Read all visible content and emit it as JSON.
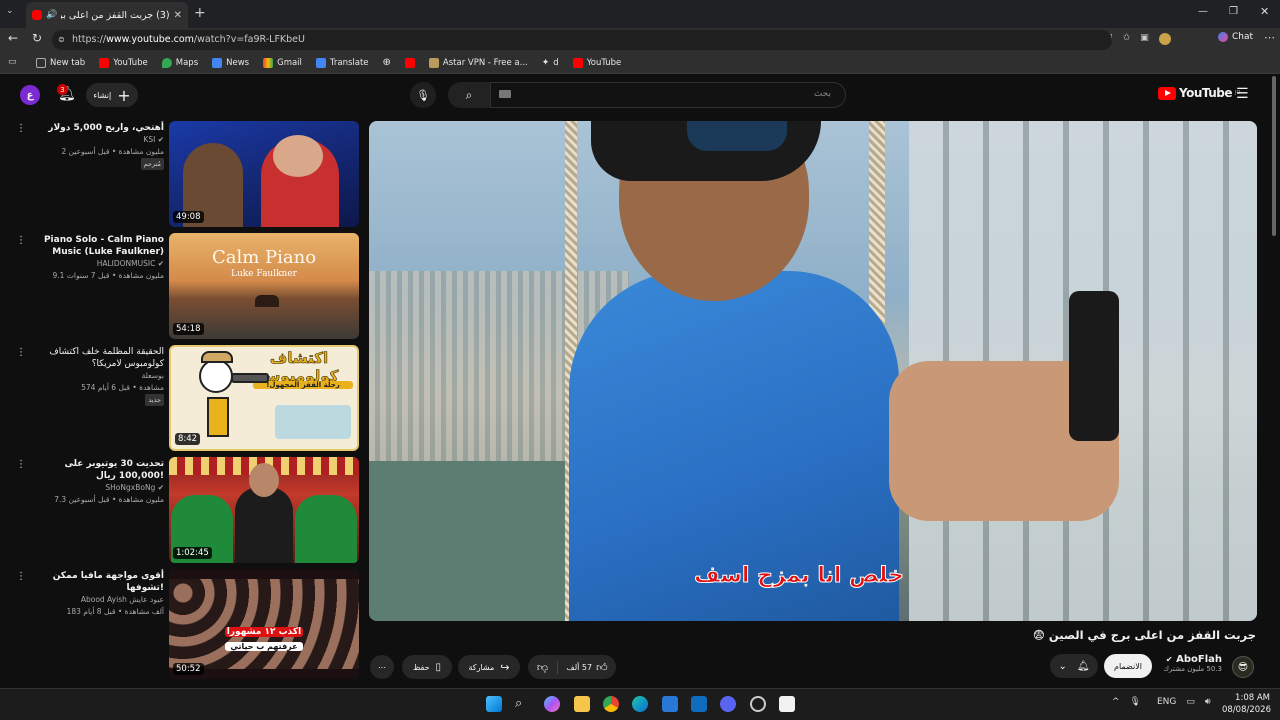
{
  "browser": {
    "tab_title": "(3) جربت القفز من اعلى برج فى",
    "url_prefix": "https://",
    "url_domain": "www.youtube.com",
    "url_path": "/watch?v=fa9R-LFKbeU",
    "chat_label": "Chat",
    "bookmarks": [
      "New tab",
      "YouTube",
      "Maps",
      "News",
      "Gmail",
      "Translate",
      "",
      "",
      "Astar VPN - Free a...",
      "d",
      "YouTube"
    ]
  },
  "youtube": {
    "create_label": "إنشاء",
    "notif_count": "3",
    "search_placeholder": "بحث",
    "logo_text": "YouTube",
    "logo_country": "JO"
  },
  "recommendations": [
    {
      "title": "أهتحي، واربح 5,000 دولار",
      "channel": "KSI",
      "stats": "2 مليون مشاهدة • قبل أسبوعين",
      "badge": "مُترجم",
      "duration": "49:08"
    },
    {
      "title": "Piano Solo - Calm Piano Music (Luke Faulkner)",
      "channel": "HALIDONMUSIC",
      "stats": "9.1 مليون مشاهدة • قبل 7 سنوات",
      "badge": "",
      "duration": "54:18",
      "thumb_title": "Calm Piano",
      "thumb_sub": "Luke Faulkner"
    },
    {
      "title": "الحقيقة المظلمة خلف اكتشاف كولومبوس لامريكا؟",
      "channel": "بوسعلة",
      "stats": "574 مشاهدة • قبل 6 أيام",
      "badge": "جديد",
      "duration": "8:42",
      "thumb_title": "اكتشاف كولومبوس",
      "thumb_sub": "رحلة القفز المجهول!"
    },
    {
      "title": "تحديت 30 يوتيوبر على 100,000 ريال!",
      "channel": "SHoNgxBoNg",
      "stats": "7.3 مليون مشاهدة • قبل أسبوعين",
      "badge": "",
      "duration": "1:02:45"
    },
    {
      "title": "أقوى مواجهة مافيا ممكن تشوفها!",
      "channel": "Abood Ayish عبود عايش",
      "stats": "183 ألف مشاهدة • قبل 8 أيام",
      "badge": "",
      "duration": "50:52",
      "thumb_title": "اكذب ١٢ مشهورا",
      "thumb_sub": "عرفتهم ب حياتي"
    }
  ],
  "video": {
    "subtitle": "خلص انا بمزح اسف",
    "title": "جربت القفز من اعلى برج في الصين 😨",
    "channel": "AboFlah",
    "subscribers": "50.3 مليون مشترك",
    "subscribe_label": "الانضمام",
    "likes": "57 ألف",
    "share_label": "مشاركة",
    "save_label": "حفظ"
  },
  "taskbar": {
    "lang": "ENG",
    "time": "1:08 AM",
    "date": "08/08/2026"
  },
  "colors": {
    "yt_red": "#ff0000",
    "bg": "#0f0f0f",
    "subtitle_red": "#e01010"
  }
}
